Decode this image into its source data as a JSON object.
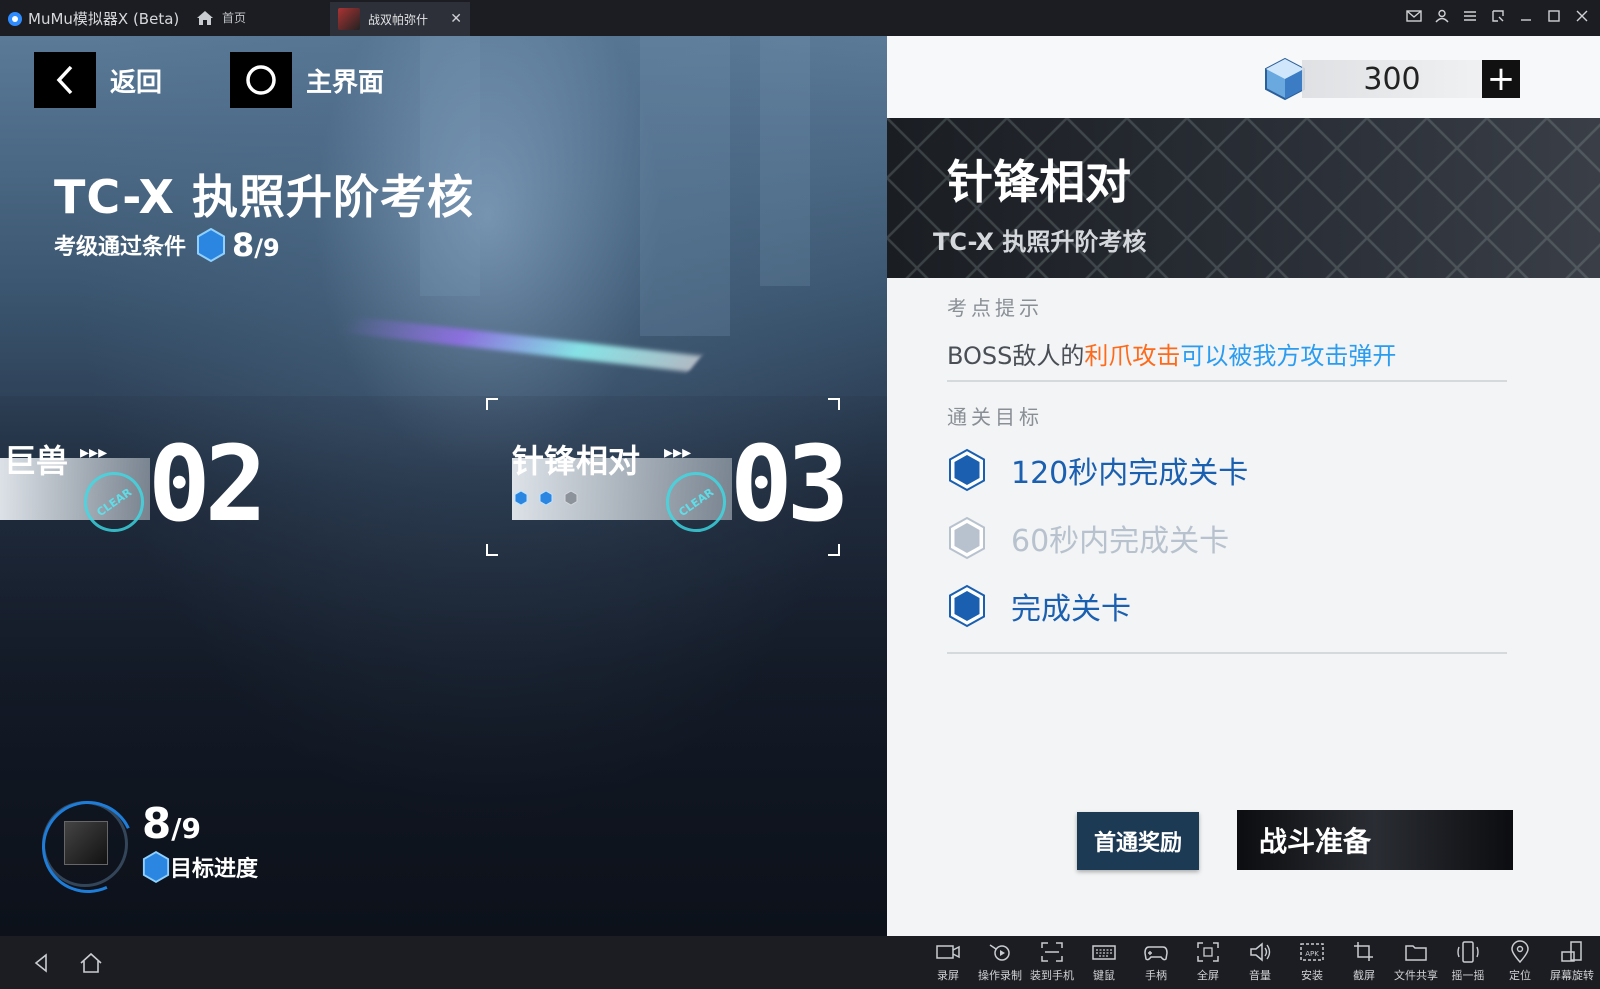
{
  "titlebar": {
    "app_name": "MuMu模拟器X (Beta)",
    "home_label": "首页",
    "tab_label": "战双帕弥什"
  },
  "nav": {
    "back_label": "返回",
    "home_label": "主界面"
  },
  "stage": {
    "title": "TC-X 执照升阶考核",
    "condition_label": "考级通过条件",
    "condition_value": "8",
    "condition_total": "/9"
  },
  "nodes": [
    {
      "name": "巨兽",
      "number": "02",
      "clear": "CLEAR"
    },
    {
      "name": "针锋相对",
      "number": "03",
      "clear": "CLEAR"
    }
  ],
  "progress": {
    "value": "8",
    "total": "/9",
    "label": "目标进度"
  },
  "currency": {
    "amount": "300",
    "add_label": "+"
  },
  "detail": {
    "title": "针锋相对",
    "subtitle": "TC-X 执照升阶考核",
    "hint_label": "考点提示",
    "hint_part1": "BOSS敌人的",
    "hint_part2": "利爪攻击",
    "hint_part3": "可以被我方攻击弹开",
    "goals_label": "通关目标",
    "goals": [
      {
        "text": "120秒内完成关卡",
        "done": true
      },
      {
        "text": "60秒内完成关卡",
        "done": false
      },
      {
        "text": "完成关卡",
        "done": true
      }
    ],
    "reward_button": "首通奖励",
    "fight_button": "战斗准备"
  },
  "colors": {
    "accent_blue": "#1a5fb0",
    "hint_orange": "#ff6a1a",
    "hint_blue": "#2b9cf0"
  },
  "toolbar": {
    "items": [
      "录屏",
      "操作录制",
      "装到手机",
      "键鼠",
      "手柄",
      "全屏",
      "音量",
      "安装",
      "截屏",
      "文件共享",
      "摇一摇",
      "定位",
      "屏幕旋转"
    ]
  }
}
